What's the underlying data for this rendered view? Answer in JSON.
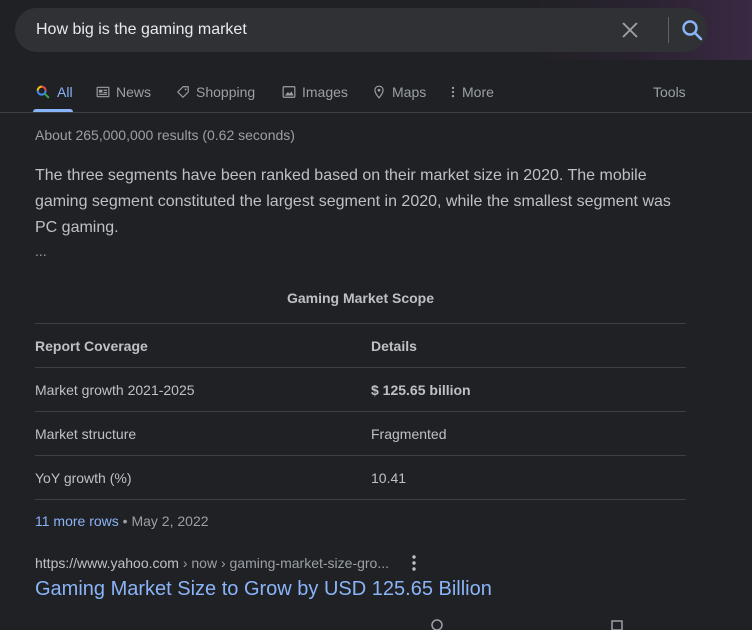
{
  "search": {
    "query": "How big is the gaming market"
  },
  "tabs": [
    {
      "label": "All",
      "icon": "search-icon",
      "active": true
    },
    {
      "label": "News",
      "icon": "news-icon"
    },
    {
      "label": "Shopping",
      "icon": "tag-icon"
    },
    {
      "label": "Images",
      "icon": "image-icon"
    },
    {
      "label": "Maps",
      "icon": "map-pin-icon"
    },
    {
      "label": "More",
      "icon": "vertical-dots-icon"
    }
  ],
  "tools_label": "Tools",
  "result_stats": "About 265,000,000 results (0.62 seconds)",
  "featured_snippet": {
    "text": "The three segments have been ranked based on their market size in 2020. The mobile gaming segment constituted the largest segment in 2020, while the smallest segment was PC gaming.",
    "ellipsis": "...",
    "table": {
      "caption": "Gaming Market Scope",
      "headers": [
        "Report Coverage",
        "Details"
      ],
      "rows": [
        [
          "Market growth 2021-2025",
          "$ 125.65 billion"
        ],
        [
          "Market structure",
          "Fragmented"
        ],
        [
          "YoY growth (%)",
          "10.41"
        ]
      ]
    },
    "more_rows": "11 more rows",
    "date": "May 2, 2022"
  },
  "result": {
    "url_domain": "https://www.yahoo.com",
    "url_path": " › now › gaming-market-size-gro...",
    "title": "Gaming Market Size to Grow by USD 125.65 Billion"
  },
  "colors": {
    "background": "#202124",
    "link": "#8ab4f8",
    "text": "#bdc1c6"
  }
}
